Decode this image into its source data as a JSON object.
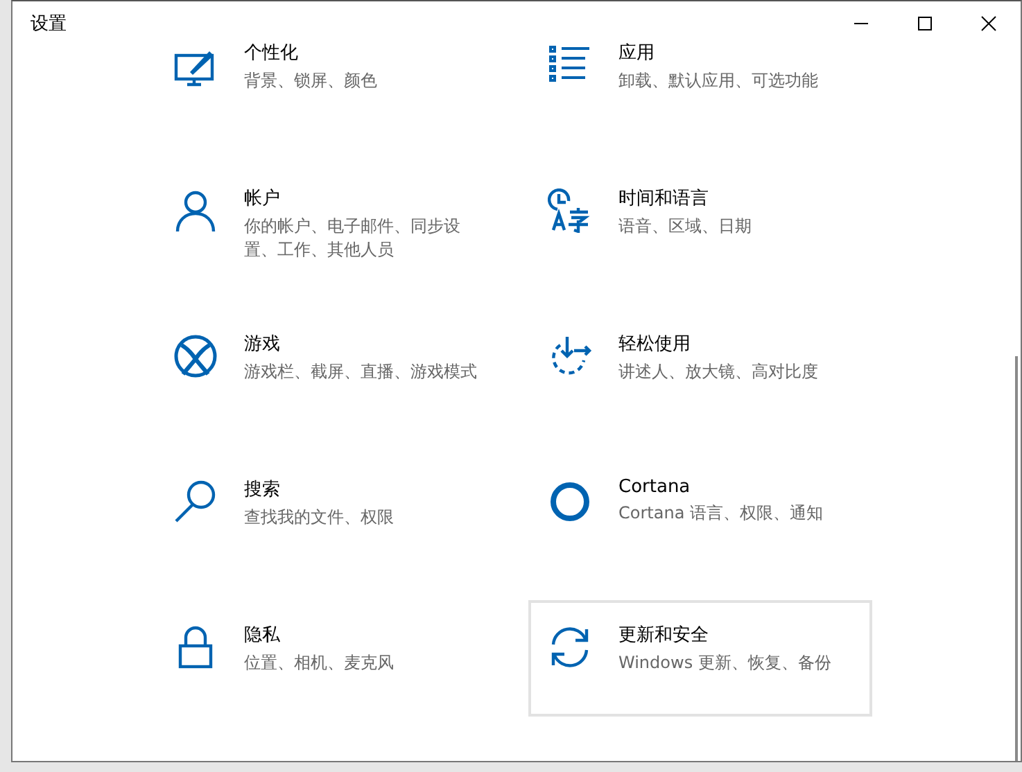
{
  "window": {
    "title": "设置"
  },
  "items": [
    {
      "kind": "personalization",
      "title": "个性化",
      "description": "背景、锁屏、颜色",
      "hovered": false
    },
    {
      "kind": "apps",
      "title": "应用",
      "description": "卸载、默认应用、可选功能",
      "hovered": false
    },
    {
      "kind": "accounts",
      "title": "帐户",
      "description": "你的帐户、电子邮件、同步设置、工作、其他人员",
      "hovered": false
    },
    {
      "kind": "time",
      "title": "时间和语言",
      "description": "语音、区域、日期",
      "hovered": false
    },
    {
      "kind": "gaming",
      "title": "游戏",
      "description": "游戏栏、截屏、直播、游戏模式",
      "hovered": false
    },
    {
      "kind": "ease",
      "title": "轻松使用",
      "description": "讲述人、放大镜、高对比度",
      "hovered": false
    },
    {
      "kind": "search",
      "title": "搜索",
      "description": "查找我的文件、权限",
      "hovered": false
    },
    {
      "kind": "cortana",
      "title": "Cortana",
      "description": "Cortana 语言、权限、通知",
      "hovered": false
    },
    {
      "kind": "privacy",
      "title": "隐私",
      "description": "位置、相机、麦克风",
      "hovered": false
    },
    {
      "kind": "update",
      "title": "更新和安全",
      "description": "Windows 更新、恢复、备份",
      "hovered": true
    }
  ]
}
